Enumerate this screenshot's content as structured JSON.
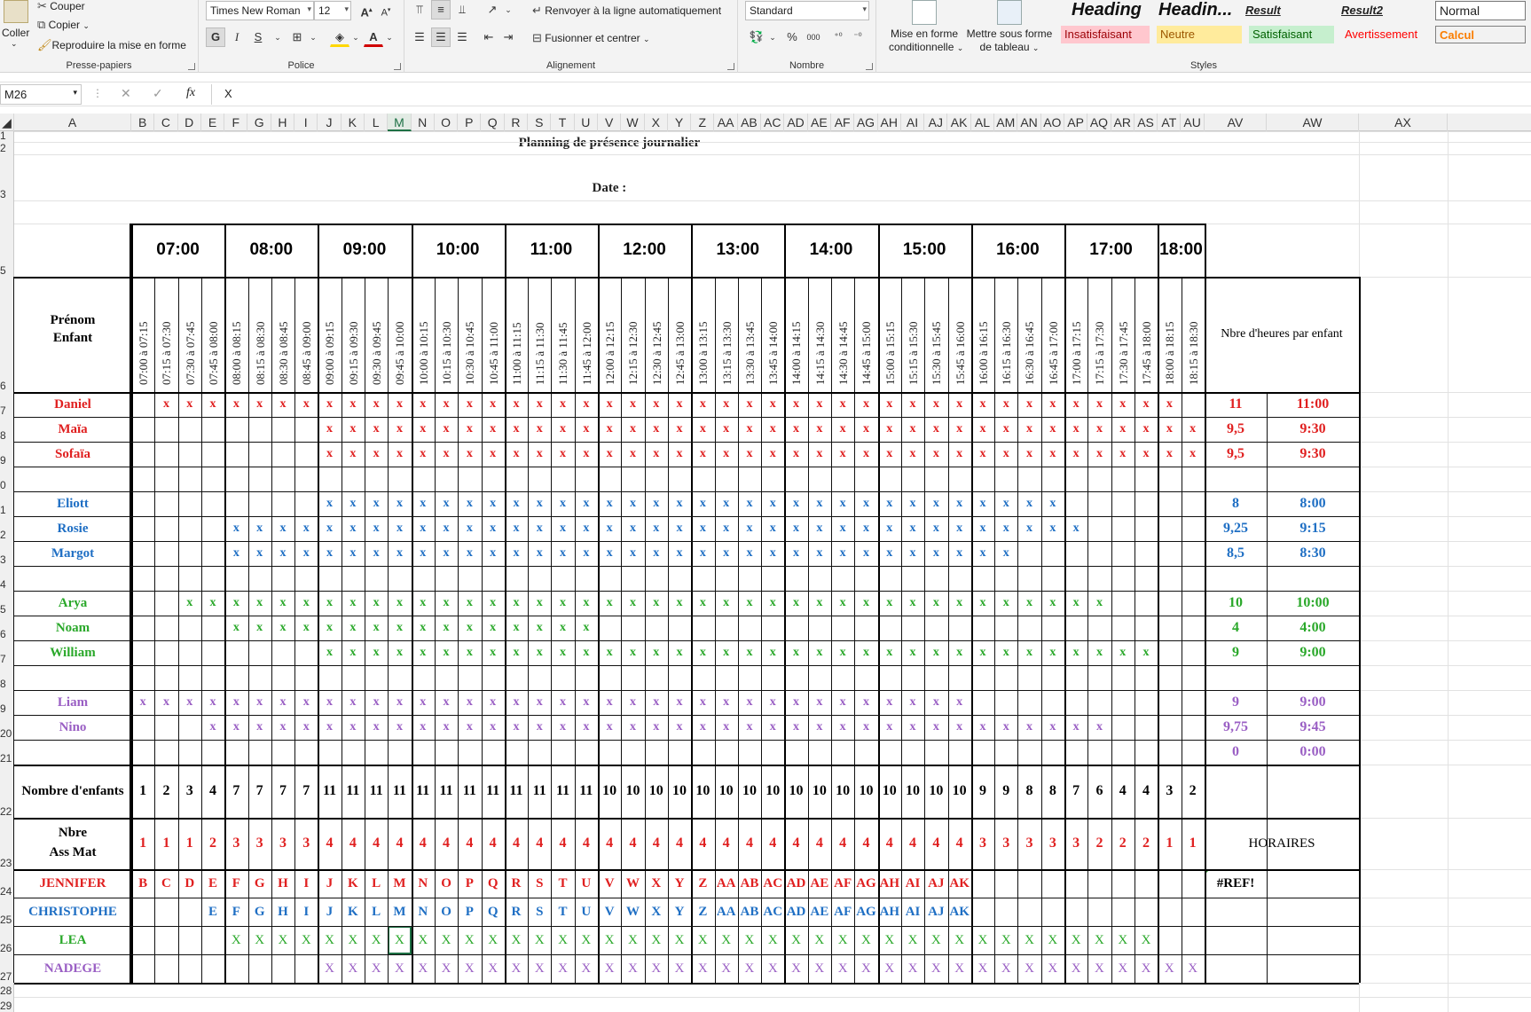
{
  "ribbon": {
    "clipboard": {
      "paste": "Coller",
      "cut": "Couper",
      "copy": "Copier",
      "format_painter": "Reproduire la mise en forme",
      "label": "Presse-papiers"
    },
    "font": {
      "name": "Times New Roman",
      "size": "12",
      "bold": "G",
      "italic": "I",
      "underline": "S",
      "label": "Police"
    },
    "alignment": {
      "wrap": "Renvoyer à la ligne automatiquement",
      "merge": "Fusionner et centrer",
      "label": "Alignement"
    },
    "number": {
      "format": "Standard",
      "percent": "%",
      "thousands": "000",
      "label": "Nombre"
    },
    "styles": {
      "conditional": [
        "Mise en forme",
        "conditionnelle"
      ],
      "table": [
        "Mettre sous forme",
        "de tableau"
      ],
      "row1": [
        {
          "text": "Heading",
          "style": "h1"
        },
        {
          "text": "Headin...",
          "style": "h2"
        },
        {
          "text": "Result",
          "style": "res"
        },
        {
          "text": "Result2",
          "style": "res2"
        },
        {
          "text": "Normal",
          "style": "normal"
        }
      ],
      "row2": [
        {
          "text": "Insatisfaisant",
          "style": "bad"
        },
        {
          "text": "Neutre",
          "style": "neutral"
        },
        {
          "text": "Satisfaisant",
          "style": "good"
        },
        {
          "text": "Avertissement",
          "style": "warn"
        },
        {
          "text": "Calcul",
          "style": "calc"
        }
      ],
      "label": "Styles"
    }
  },
  "formula_bar": {
    "name_box": "M26",
    "fx": "fx",
    "formula": "X"
  },
  "columns": [
    "A",
    "B",
    "C",
    "D",
    "E",
    "F",
    "G",
    "H",
    "I",
    "J",
    "K",
    "L",
    "M",
    "N",
    "O",
    "P",
    "Q",
    "R",
    "S",
    "T",
    "U",
    "V",
    "W",
    "X",
    "Y",
    "Z",
    "AA",
    "AB",
    "AC",
    "AD",
    "AE",
    "AF",
    "AG",
    "AH",
    "AI",
    "AJ",
    "AK",
    "AL",
    "AM",
    "AN",
    "AO",
    "AP",
    "AQ",
    "AR",
    "AS",
    "AT",
    "AU",
    "AV",
    "AW",
    "AX"
  ],
  "selected_column": "M",
  "rows": [
    "1",
    "2",
    "3",
    "",
    "5",
    "6",
    "7",
    "8",
    "9",
    "0",
    "1",
    "2",
    "3",
    "4",
    "5",
    "6",
    "7",
    "8",
    "9",
    "20",
    "21",
    "22",
    "23",
    "24",
    "25",
    "26",
    "27",
    "28",
    "29"
  ],
  "sheet": {
    "title": "Planning de présence journalier",
    "date_label": "Date :",
    "hours": [
      "07:00",
      "08:00",
      "09:00",
      "10:00",
      "11:00",
      "12:00",
      "13:00",
      "14:00",
      "15:00",
      "16:00",
      "17:00",
      "18:00"
    ],
    "slots": [
      "07:00 à 07:15",
      "07:15 à 07:30",
      "07:30 à 07:45",
      "07:45 à 08:00",
      "08:00 à 08:15",
      "08:15 à 08:30",
      "08:30 à 08:45",
      "08:45 à 09:00",
      "09:00 à 09:15",
      "09:15 à 09:30",
      "09:30 à 09:45",
      "09:45 à 10:00",
      "10:00 à 10:15",
      "10:15 à 10:30",
      "10:30 à 10:45",
      "10:45 à 11:00",
      "11:00 à 11:15",
      "11:15 à 11:30",
      "11:30 à 11:45",
      "11:45 à 12:00",
      "12:00 à 12:15",
      "12:15 à 12:30",
      "12:30 à 12:45",
      "12:45 à 13:00",
      "13:00 à 13:15",
      "13:15 à 13:30",
      "13:30 à 13:45",
      "13:45 à 14:00",
      "14:00 à 14:15",
      "14:15 à 14:30",
      "14:30 à 14:45",
      "14:45 à 15:00",
      "15:00 à 15:15",
      "15:15 à 15:30",
      "15:30 à 15:45",
      "15:45 à 16:00",
      "16:00 à 16:15",
      "16:15 à 16:30",
      "16:30 à 16:45",
      "16:45 à 17:00",
      "17:00 à 17:15",
      "17:15 à 17:30",
      "17:30 à 17:45",
      "17:45 à 18:00",
      "18:00 à 18:15",
      "18:15 à 18:30"
    ],
    "header_name": [
      "Prénom",
      "Enfant"
    ],
    "header_hours": "Nbre d'heures par enfant",
    "children": [
      {
        "name": "Daniel",
        "color": "#e02020",
        "start": 1,
        "end": 44,
        "hours": "11",
        "time": "11:00"
      },
      {
        "name": "Maïa",
        "color": "#e02020",
        "start": 8,
        "end": 45,
        "hours": "9,5",
        "time": "9:30"
      },
      {
        "name": "Sofaïa",
        "color": "#e02020",
        "start": 8,
        "end": 45,
        "hours": "9,5",
        "time": "9:30"
      },
      null,
      {
        "name": "Eliott",
        "color": "#1f6fc4",
        "start": 8,
        "end": 39,
        "hours": "8",
        "time": "8:00"
      },
      {
        "name": "Rosie",
        "color": "#1f6fc4",
        "start": 4,
        "end": 40,
        "hours": "9,25",
        "time": "9:15"
      },
      {
        "name": "Margot",
        "color": "#1f6fc4",
        "start": 4,
        "end": 37,
        "hours": "8,5",
        "time": "8:30"
      },
      null,
      {
        "name": "Arya",
        "color": "#2aa82a",
        "start": 2,
        "end": 41,
        "hours": "10",
        "time": "10:00"
      },
      {
        "name": "Noam",
        "color": "#2aa82a",
        "start": 4,
        "end": 19,
        "hours": "4",
        "time": "4:00"
      },
      {
        "name": "William",
        "color": "#2aa82a",
        "start": 8,
        "end": 43,
        "hours": "9",
        "time": "9:00"
      },
      null,
      {
        "name": "Liam",
        "color": "#9a5fc4",
        "start": 0,
        "end": 35,
        "hours": "9",
        "time": "9:00"
      },
      {
        "name": "Nino",
        "color": "#9a5fc4",
        "start": 3,
        "end": 41,
        "hours": "9,75",
        "time": "9:45"
      },
      {
        "name": "",
        "color": "#9a5fc4",
        "start": -1,
        "end": -1,
        "hours": "0",
        "time": "0:00"
      }
    ],
    "mark": "x",
    "count_label": "Nombre d'enfants",
    "counts": [
      "1",
      "2",
      "3",
      "4",
      "7",
      "7",
      "7",
      "7",
      "11",
      "11",
      "11",
      "11",
      "11",
      "11",
      "11",
      "11",
      "11",
      "11",
      "11",
      "11",
      "10",
      "10",
      "10",
      "10",
      "10",
      "10",
      "10",
      "10",
      "10",
      "10",
      "10",
      "10",
      "10",
      "10",
      "10",
      "10",
      "9",
      "9",
      "8",
      "8",
      "7",
      "6",
      "4",
      "4",
      "3",
      "2"
    ],
    "assmat_label": [
      "Nbre",
      "Ass Mat"
    ],
    "assmat": [
      "1",
      "1",
      "1",
      "2",
      "3",
      "3",
      "3",
      "3",
      "4",
      "4",
      "4",
      "4",
      "4",
      "4",
      "4",
      "4",
      "4",
      "4",
      "4",
      "4",
      "4",
      "4",
      "4",
      "4",
      "4",
      "4",
      "4",
      "4",
      "4",
      "4",
      "4",
      "4",
      "4",
      "4",
      "4",
      "4",
      "3",
      "3",
      "3",
      "3",
      "3",
      "2",
      "2",
      "2",
      "1",
      "1"
    ],
    "horaires_label": "HORAIRES",
    "ref_error": "#REF!",
    "staff": [
      {
        "name": "JENNIFER",
        "color": "#e02020",
        "start": 0,
        "end": 35,
        "letters": true
      },
      {
        "name": "CHRISTOPHE",
        "color": "#1f6fc4",
        "start": 3,
        "end": 35,
        "letters": true
      },
      {
        "name": "LEA",
        "color": "#2aa82a",
        "start": 4,
        "end": 43,
        "letters": false,
        "mark": "X"
      },
      {
        "name": "NADEGE",
        "color": "#9a5fc4",
        "start": 8,
        "end": 45,
        "letters": false,
        "mark": "X"
      }
    ],
    "colors": {
      "red": "#e02020",
      "blue": "#1f6fc4",
      "green": "#2aa82a",
      "purple": "#9a5fc4",
      "selection": "#1e7145"
    }
  }
}
